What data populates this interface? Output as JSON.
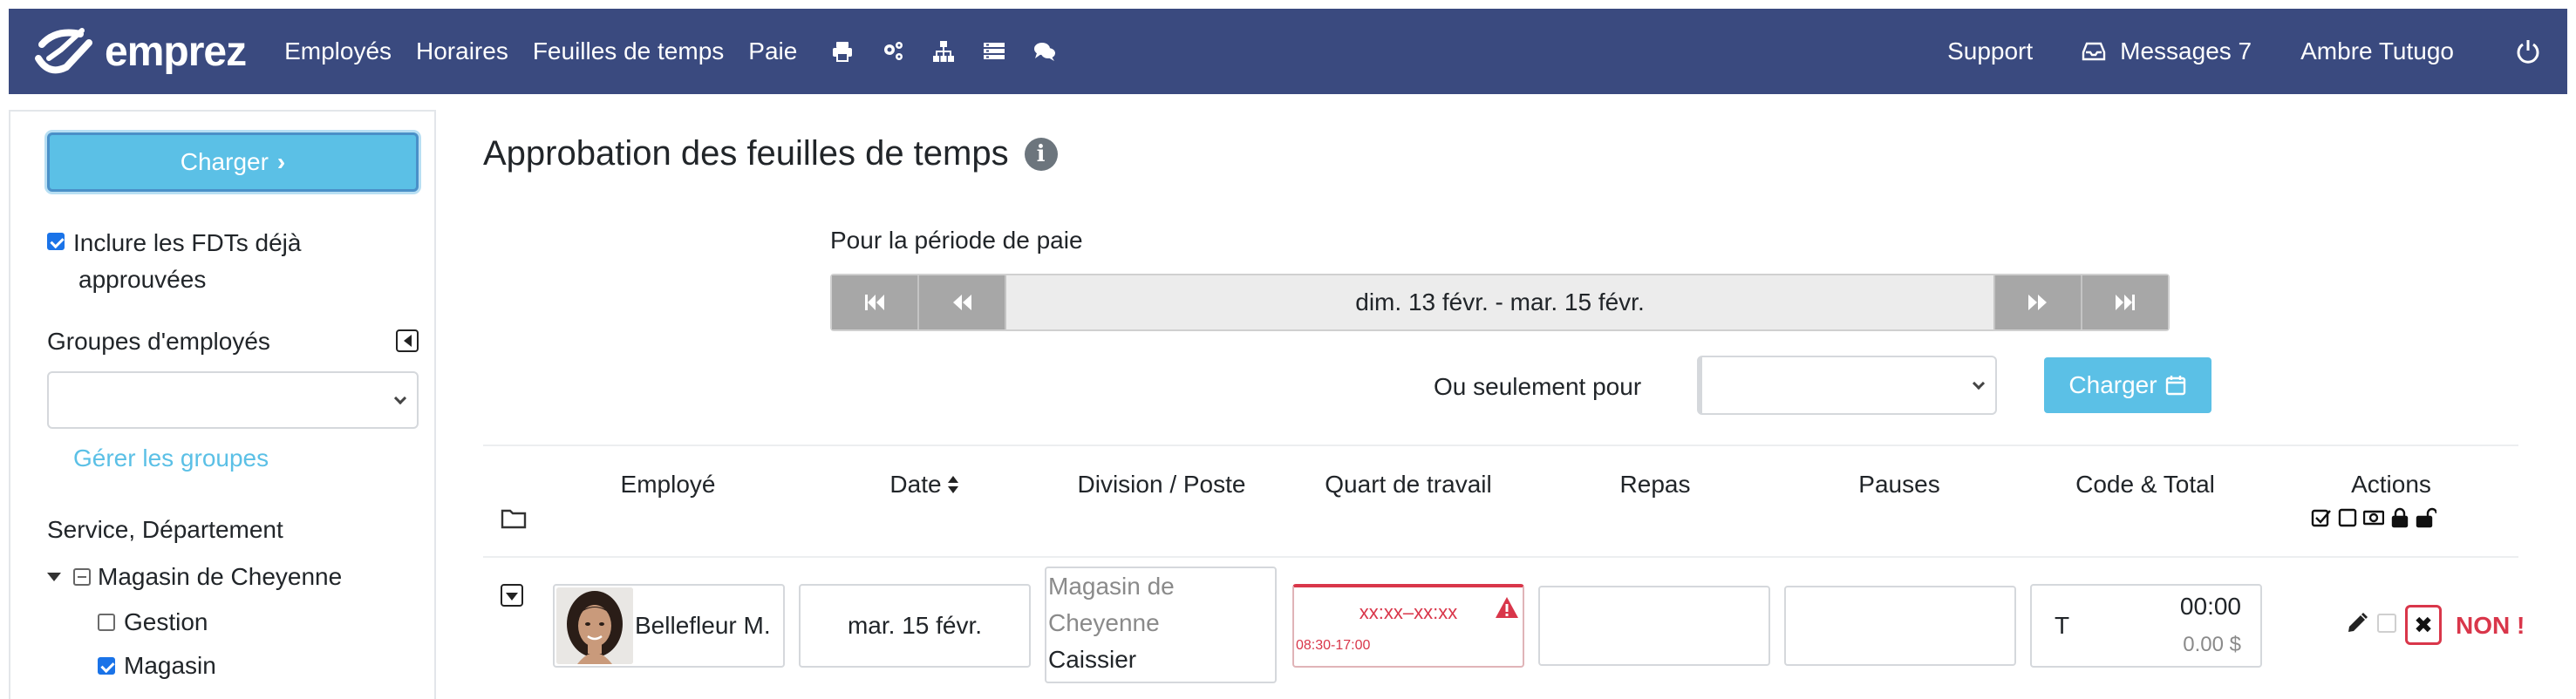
{
  "nav": {
    "brand": "emprez",
    "links": [
      "Employés",
      "Horaires",
      "Feuilles de temps",
      "Paie"
    ],
    "icons": [
      "print-icon",
      "cogs-icon",
      "sitemap-icon",
      "list-icon",
      "comments-icon"
    ],
    "support": "Support",
    "messages": "Messages 7",
    "user": "Ambre Tutugo",
    "brand_color": "#3a4a7f"
  },
  "sidebar": {
    "charger_label": "Charger",
    "include_line1": "Inclure les FDTs déjà",
    "include_line2": "approuvées",
    "include_checked": true,
    "groups_label": "Groupes d'employés",
    "groups_selected": "",
    "manage_groups": "Gérer les groupes",
    "service_label": "Service, Département",
    "tree": {
      "root": "Magasin de Cheyenne",
      "children": [
        {
          "label": "Gestion",
          "checked": false
        },
        {
          "label": "Magasin",
          "checked": true
        }
      ]
    }
  },
  "main": {
    "title": "Approbation des feuilles de temps",
    "period_label": "Pour la période de paie",
    "period_text": "dim. 13 févr. - mar. 15 févr.",
    "only_for_label": "Ou seulement pour",
    "only_for_selected": "",
    "charger_label": "Charger"
  },
  "table": {
    "headers": {
      "employee": "Employé",
      "date": "Date",
      "division": "Division / Poste",
      "shift": "Quart de travail",
      "meals": "Repas",
      "breaks": "Pauses",
      "code_total": "Code & Total",
      "actions": "Actions"
    },
    "row": {
      "employee": "Bellefleur M.",
      "date": "mar. 15 févr.",
      "division_line1": "Magasin de",
      "division_line2": "Cheyenne",
      "position": "Caissier",
      "shift_actual": "xx:xx–xx:xx",
      "shift_scheduled": "08:30-17:00",
      "code": "T",
      "total_time": "00:00",
      "total_amount": "0.00 $",
      "status": "NON !",
      "status_color": "#d9364a"
    }
  }
}
